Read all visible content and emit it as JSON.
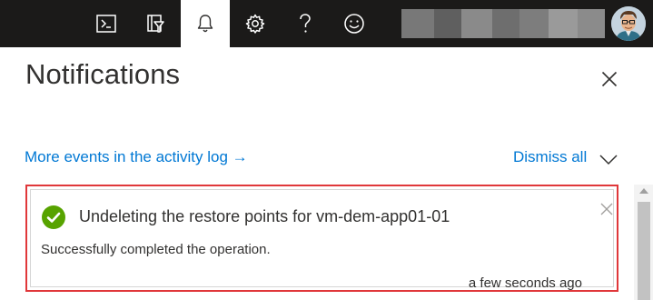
{
  "topbar": {
    "buttons": [
      {
        "name": "cloud-shell-icon"
      },
      {
        "name": "directory-filter-icon"
      },
      {
        "name": "notifications-bell-icon",
        "active": true
      },
      {
        "name": "settings-gear-icon"
      },
      {
        "name": "help-question-icon"
      },
      {
        "name": "feedback-smiley-icon"
      }
    ],
    "account": {
      "redacted": true
    }
  },
  "panel": {
    "title": "Notifications",
    "activity_link": "More events in the activity log →",
    "dismiss_all": "Dismiss all"
  },
  "notification": {
    "status": "success",
    "title": "Undeleting the restore points for vm-dem-app01-01",
    "message": "Successfully completed the operation.",
    "time": "a few seconds ago"
  },
  "colors": {
    "topbar_bg": "#1b1a19",
    "link": "#0078d4",
    "success": "#57a300",
    "highlight_border": "#e0373a"
  }
}
